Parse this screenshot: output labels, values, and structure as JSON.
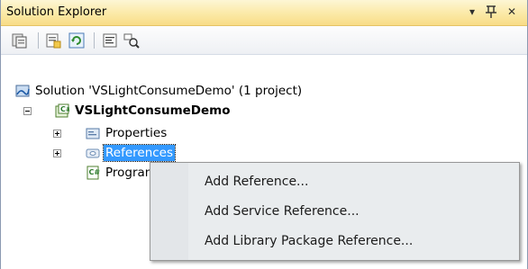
{
  "window": {
    "title": "Solution Explorer",
    "buttons": {
      "dropdown": "▾",
      "pin": "ᵻ",
      "close": "✕"
    }
  },
  "toolbar": {
    "tools": [
      {
        "icon": "show-all-files-icon"
      },
      {
        "icon": "properties-icon"
      },
      {
        "icon": "refresh-icon"
      },
      {
        "icon": "view-code-icon"
      },
      {
        "icon": "class-diagram-icon"
      }
    ]
  },
  "tree": {
    "solution": {
      "label": "Solution 'VSLightConsumeDemo' (1 project)"
    },
    "project": {
      "label": "VSLightConsumeDemo",
      "expanded": true
    },
    "items": [
      {
        "label": "Properties",
        "expanded": false
      },
      {
        "label": "References",
        "expanded": false,
        "selected": true
      },
      {
        "label": "Program.cs"
      }
    ]
  },
  "context_menu": {
    "items": [
      {
        "label": "Add Reference..."
      },
      {
        "label": "Add Service Reference..."
      },
      {
        "label": "Add Library Package Reference..."
      }
    ]
  },
  "colors": {
    "titlebar": "#fbe9a6",
    "selection": "#3399ff",
    "frame": "#293955"
  }
}
